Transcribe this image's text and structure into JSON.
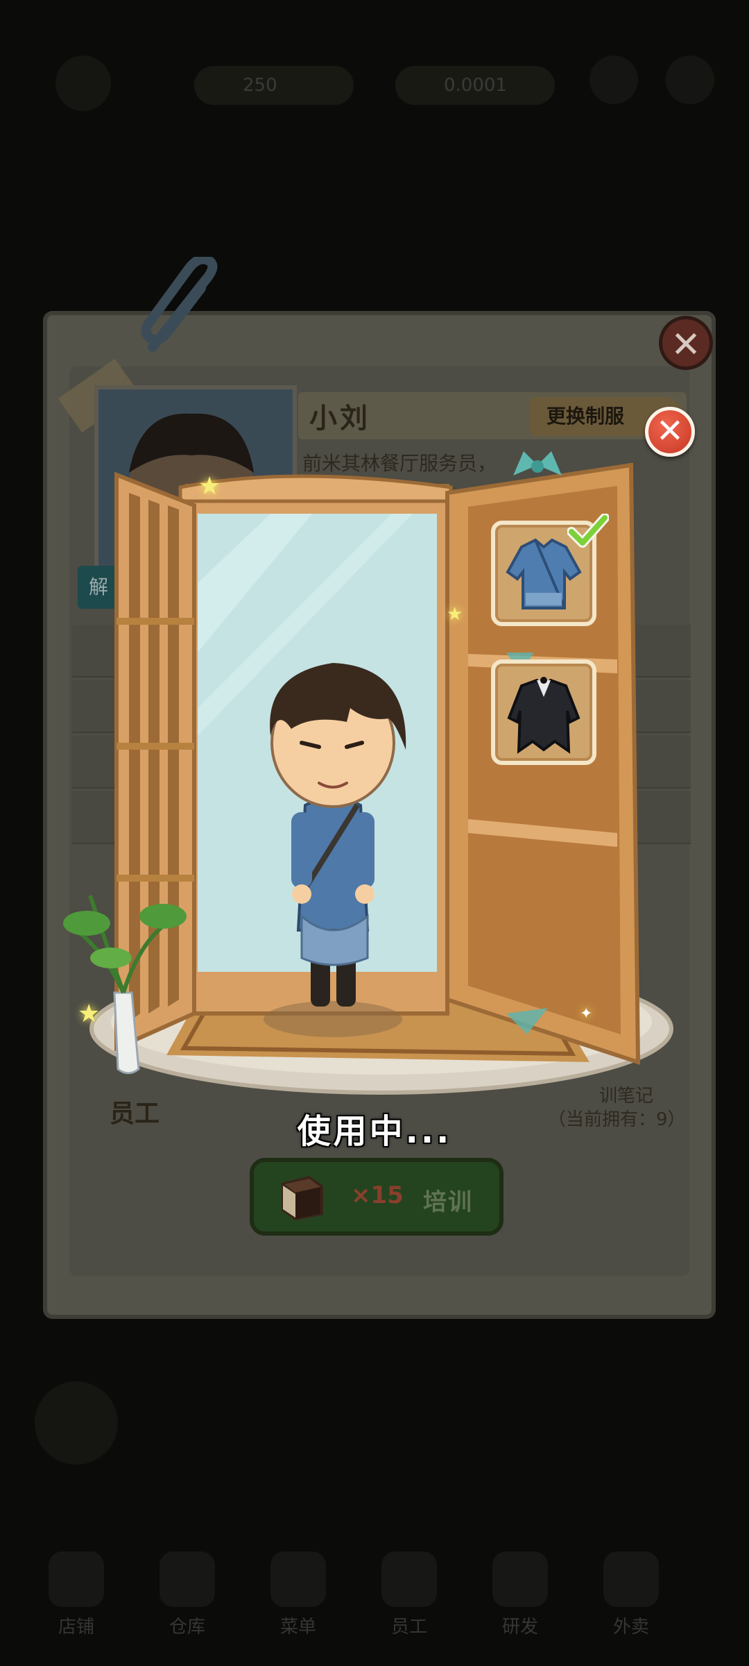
{
  "hud": {
    "coin_value": "250",
    "cash_value": "0.0001"
  },
  "profile": {
    "name": "小刘",
    "change_uniform_label": "更换制服",
    "description": "前米其林餐厅服务员，",
    "side_tab_label": "解",
    "staff_label": "员工",
    "notes_label": "训笔记",
    "owned_label": "（当前拥有：9）"
  },
  "train_button": {
    "count": "×15",
    "label": "培训"
  },
  "wardrobe": {
    "status_text": "使用中...",
    "uniforms": [
      {
        "name": "blue-uniform",
        "selected": true
      },
      {
        "name": "black-tailcoat",
        "selected": false
      }
    ]
  },
  "bottom_nav": [
    {
      "label": "店铺"
    },
    {
      "label": "仓库"
    },
    {
      "label": "菜单"
    },
    {
      "label": "员工"
    },
    {
      "label": "研发"
    },
    {
      "label": "外卖"
    }
  ],
  "colors": {
    "close_red": "#d9432c",
    "train_green": "#24441f",
    "check_green": "#7ed03a",
    "wood": "#d9a066"
  }
}
